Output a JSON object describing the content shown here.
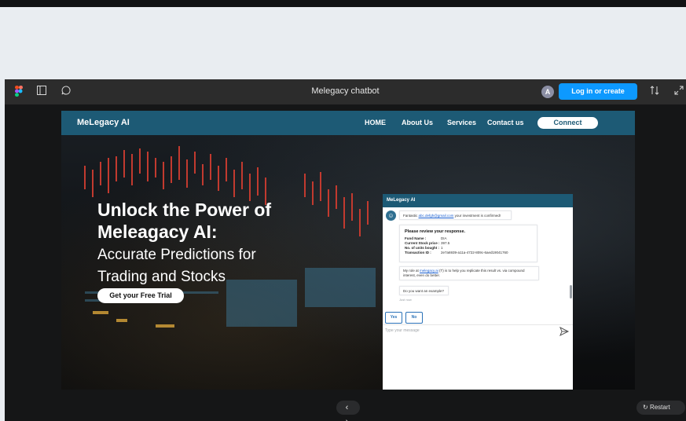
{
  "figma": {
    "title": "Melegacy chatbot",
    "avatar_initial": "A",
    "login_label": "Log in or create account",
    "icons": [
      "figma-logo-icon",
      "panel-icon",
      "comment-icon",
      "options-icon",
      "expand-icon"
    ],
    "accent": "#0d99ff"
  },
  "site": {
    "brand": "MeLegacy AI",
    "nav": [
      "HOME",
      "About Us",
      "Services",
      "Contact us"
    ],
    "connect_label": "Connect",
    "nav_color": "#1d5a75",
    "hero": {
      "title_line1": "Unlock the Power of",
      "title_line2": "Meleagacy AI:",
      "sub_line1": "Accurate Predictions for",
      "sub_line2": "Trading and Stocks",
      "cta": "Get your Free Trial"
    }
  },
  "chat": {
    "header": "MeLegacy AI",
    "msg1_prefix": "Fantastic",
    "msg1_email": "abc.defgh@gmail.com",
    "msg1_suffix": "your investment is confirmed!",
    "review_title": "Please review your response.",
    "review": [
      {
        "k": "Fund Name :",
        "v": "DIA"
      },
      {
        "k": "Current Stock price :",
        "v": "397.5"
      },
      {
        "k": "No. of units bought :",
        "v": "1"
      },
      {
        "k": "Transaction ID :",
        "v": "2e7a6939-a11a-4722-809c-6aed19041760"
      }
    ],
    "msg3_prefix": "My role at",
    "msg3_link": "melegacy.ai",
    "msg3_suffix": "(T) is to help you replicate this result vs. via compound interest, even do better.",
    "msg4": "Do you want an example?",
    "time_note": "Just now",
    "yes_label": "Yes",
    "no_label": "No",
    "input_placeholder": "Type your message"
  },
  "controls": {
    "nav_arrows": "‹ ›",
    "restart_label": "Restart"
  }
}
